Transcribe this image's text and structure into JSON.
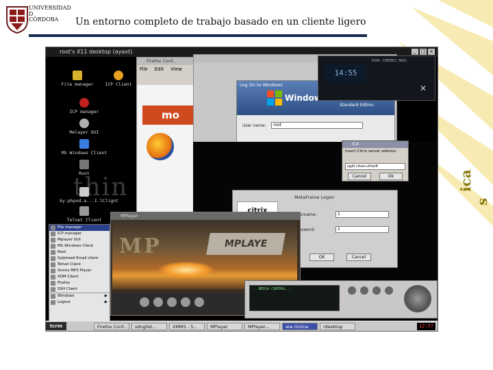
{
  "slide": {
    "title": "Un entorno completo de trabajo basado en un cliente ligero",
    "logo_text": "UNIVERSIDAD\nD\nCÓRDOBA",
    "side_text_1": "ica",
    "side_text_2": "s"
  },
  "colors": {
    "title_rule": "#15294f",
    "deco": "#f5e59a",
    "side_text": "#8a7a10"
  },
  "screen": {
    "title": "root's X11 desktop (ayaxt)",
    "desktop_icons": [
      {
        "label": "File manager",
        "icon": "folder-icon",
        "color": "#d9b12d"
      },
      {
        "label": "ICP Client",
        "icon": "sun-icon",
        "color": "#e8a020"
      },
      {
        "label": "ICP manager",
        "icon": "app-icon",
        "color": "#c02020"
      },
      {
        "label": "Melayer OUI",
        "icon": "cd-icon",
        "color": "#b0b0b0"
      },
      {
        "label": "MS Windows Client",
        "icon": "windows-icon",
        "color": "#3a7de0"
      },
      {
        "label": "Root",
        "icon": "terminal-icon",
        "color": "#777777"
      },
      {
        "label": "ky.phpod.a...I.lClignt",
        "icon": "app-icon",
        "color": "#cccccc"
      },
      {
        "label": "Telnet Client",
        "icon": "terminal-icon",
        "color": "#999999"
      }
    ],
    "watermark": "thin",
    "firefox": {
      "title": "Firefox Conf...",
      "menu": [
        "File",
        "Edit",
        "View"
      ],
      "brand": "mo"
    },
    "login_window": {
      "title": "Log On to Windows",
      "product": "Windows Server 2003",
      "edition": "Standard Edition",
      "user_label": "User name:",
      "user_value": "root"
    },
    "media_panel": {
      "lcd": "14:55",
      "track": "KIRA JIMENEZ BROS"
    },
    "small_dialog": {
      "title": "ICA",
      "label": "Insert Citrix server address",
      "value": "ogdt.citser.ultisoft",
      "ok": "Cancel",
      "cancel": "Ok"
    },
    "citrix_login": {
      "title": "MetaFrame Logon",
      "logo": "citrix",
      "username_label": "Username:",
      "username_value": "1",
      "password_label": "Password:",
      "password_value": "1",
      "ok": "OK",
      "cancel": "Cancel"
    },
    "mplayer": {
      "title": "MPlayer",
      "logo_left": "MP",
      "logo_right": "MPLAYE"
    },
    "skin_player": {
      "lcd_text": "...MEDIA CONTROL..."
    },
    "start_menu": [
      {
        "label": "File manager",
        "selected": true
      },
      {
        "label": "ICP manager"
      },
      {
        "label": "Mplayer GUI"
      },
      {
        "label": "MS Windows Client"
      },
      {
        "label": "Root"
      },
      {
        "label": "Sylpheed Email client"
      },
      {
        "label": "Telnet Client"
      },
      {
        "label": "Xmms MP3 Player"
      },
      {
        "label": "XDM Client"
      },
      {
        "label": "Firefox"
      },
      {
        "label": "SSH Client"
      },
      {
        "label": "Windows",
        "sep": true,
        "arrow": "▶"
      },
      {
        "label": "Logout",
        "arrow": "▶"
      }
    ],
    "taskbar": {
      "start": "tcrm",
      "tasks": [
        {
          "label": "Firefox Conf..."
        },
        {
          "label": "sdnglist..."
        },
        {
          "label": "XMMS - 5..."
        },
        {
          "label": "MPlayer"
        },
        {
          "label": "MPlayer..."
        },
        {
          "label": "ww Online",
          "active": true
        },
        {
          "label": "rdesktop"
        }
      ],
      "clock": "12:57"
    }
  }
}
